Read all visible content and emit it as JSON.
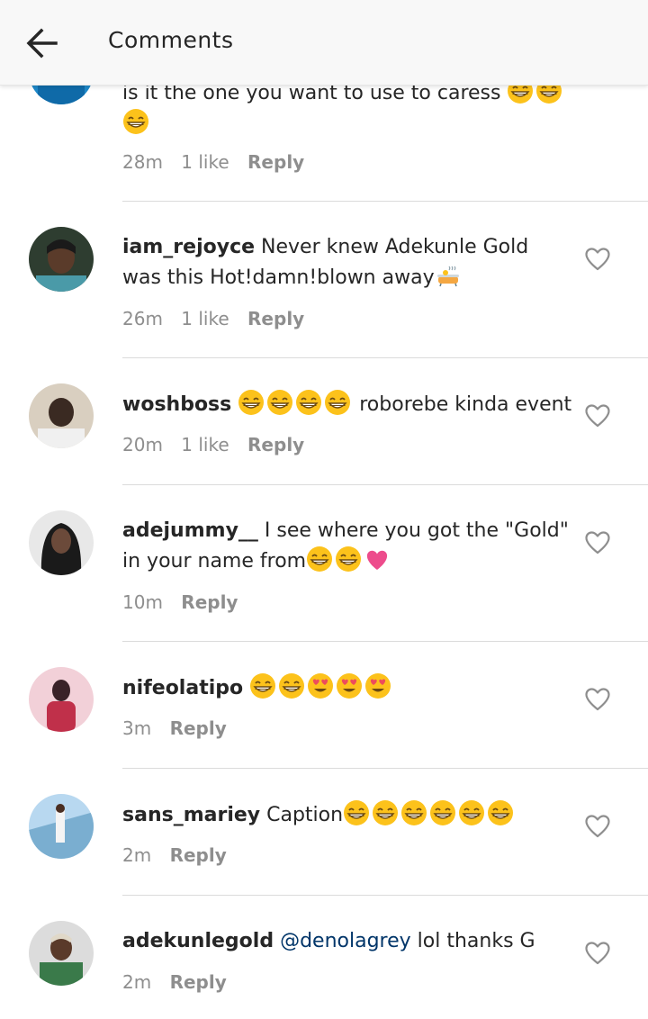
{
  "header": {
    "title": "Comments"
  },
  "comments": [
    {
      "user": "",
      "text": "is it the one you want to use to caress",
      "time": "28m",
      "likes": "1 like",
      "reply": "Reply"
    },
    {
      "user": "iam_rejoyce",
      "text": "Never knew Adekunle Gold was this Hot!damn!blown away",
      "time": "26m",
      "likes": "1 like",
      "reply": "Reply"
    },
    {
      "user": "woshboss",
      "text": "roborebe kinda event",
      "time": "20m",
      "likes": "1 like",
      "reply": "Reply"
    },
    {
      "user": "adejummy__",
      "text": "I see where you got the \"Gold\" in your name from",
      "time": "10m",
      "likes": "",
      "reply": "Reply"
    },
    {
      "user": "nifeolatipo",
      "text": "",
      "time": "3m",
      "likes": "",
      "reply": "Reply"
    },
    {
      "user": "sans_mariey",
      "text": "Caption",
      "time": "2m",
      "likes": "",
      "reply": "Reply"
    },
    {
      "user": "adekunlegold",
      "mention": "@denolagrey",
      "text": "lol thanks G",
      "time": "2m",
      "likes": "",
      "reply": "Reply"
    }
  ],
  "colors": {
    "accent_link": "#003569",
    "meta_gray": "#8e8e8e"
  }
}
